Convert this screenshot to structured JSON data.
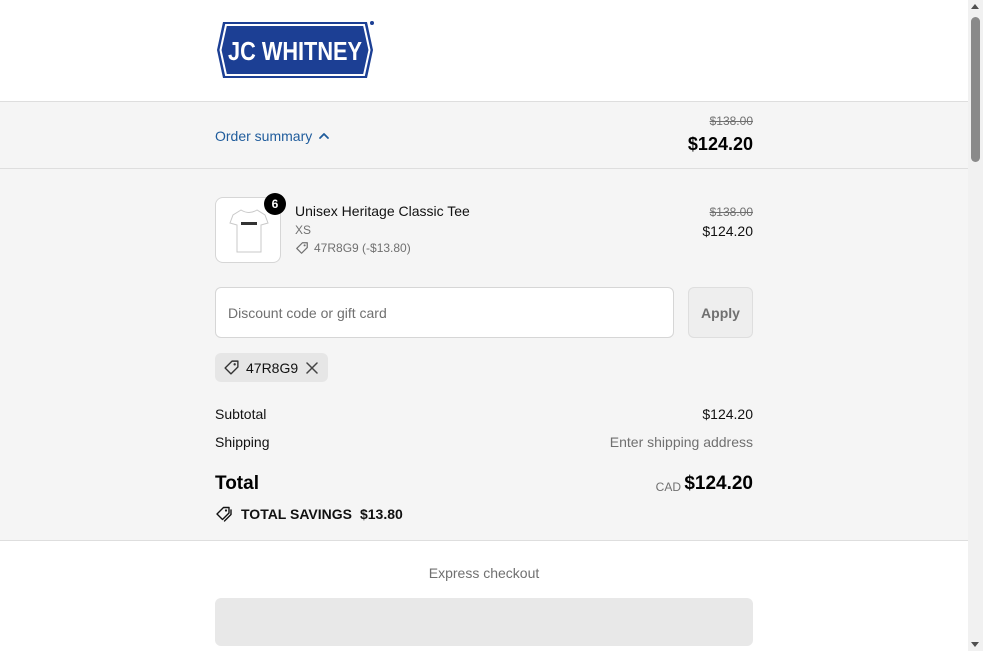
{
  "brand": {
    "logo_text": "JC WHITNEY",
    "logo_color": "#1c3f94"
  },
  "order_summary": {
    "toggle_label": "Order summary",
    "original_total": "$138.00",
    "discounted_total": "$124.20"
  },
  "product": {
    "quantity": "6",
    "name": "Unisex Heritage Classic Tee",
    "variant": "XS",
    "discount_line": "47R8G9 (-$13.80)",
    "original_price": "$138.00",
    "price": "$124.20"
  },
  "discount": {
    "placeholder": "Discount code or gift card",
    "value": "",
    "apply_label": "Apply",
    "applied_code": "47R8G9"
  },
  "totals": {
    "subtotal_label": "Subtotal",
    "subtotal_value": "$124.20",
    "shipping_label": "Shipping",
    "shipping_value": "Enter shipping address",
    "total_label": "Total",
    "currency": "CAD",
    "total_value": "$124.20",
    "savings_label": "TOTAL SAVINGS",
    "savings_value": "$13.80"
  },
  "express": {
    "label": "Express checkout"
  },
  "colors": {
    "link": "#1f5c9c",
    "panel_bg": "#f5f5f5",
    "muted_text": "#707070"
  }
}
